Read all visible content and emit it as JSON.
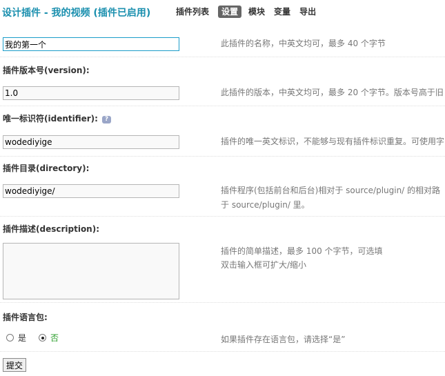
{
  "header": {
    "title": "设计插件 - 我的视频 (插件已启用)",
    "nav": [
      "插件列表",
      "设置",
      "模块",
      "变量",
      "导出"
    ],
    "active_nav": "设置"
  },
  "fields": {
    "name": {
      "value": "我的第一个",
      "hint": "此插件的名称，中英文均可，最多 40 个字节"
    },
    "version": {
      "label": "插件版本号(version):",
      "value": "1.0",
      "hint": "此插件的版本，中英文均可，最多 20 个字节。版本号高于旧"
    },
    "identifier": {
      "label": "唯一标识符(identifier):",
      "value": "wodediyige",
      "hint": "插件的唯一英文标识，不能够与现有插件标识重复。可使用字"
    },
    "directory": {
      "label": "插件目录(directory):",
      "value": "wodediyige/",
      "hint_line1": "插件程序(包括前台和后台)相对于 source/plugin/ 的相对路",
      "hint_line2": "于 source/plugin/ 里。"
    },
    "description": {
      "label": "插件描述(description):",
      "value": "",
      "hint_line1": "插件的简单描述，最多 100 个字节，可选填",
      "hint_line2": "双击输入框可扩大/缩小"
    },
    "langpack": {
      "label": "插件语言包:",
      "options": [
        "是",
        "否"
      ],
      "selected": "否",
      "hint": "如果插件存在语言包，请选择“是”"
    }
  },
  "help_icon": {
    "glyph": "?"
  },
  "submit": {
    "label": "提交"
  },
  "colors": {
    "title": "#1a8fae",
    "active_tab_bg": "#666666",
    "hint_text": "#777777",
    "selected_option": "#2a9d2a"
  }
}
